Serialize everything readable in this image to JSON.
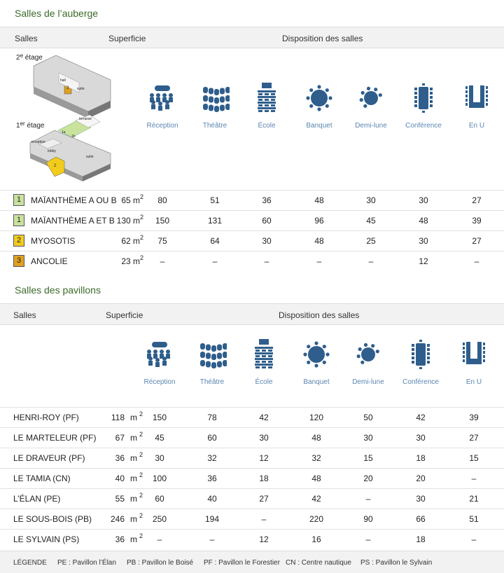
{
  "auberge": {
    "title": "Salles de l’auberge",
    "headers": {
      "salles": "Salles",
      "superficie": "Superficie",
      "disposition": "Disposition des salles"
    },
    "plan": {
      "floor2_label": "2",
      "floor2_suffix": "e",
      "floor2_word": " étage",
      "floor1_label": "1",
      "floor1_suffix": "er",
      "floor1_word": " étage",
      "tags": [
        "hall",
        "suite",
        "terrasse",
        "1a",
        "1b",
        "réception",
        "lobby",
        "suite"
      ],
      "room_numbers": [
        "3",
        "2"
      ]
    },
    "rows": [
      {
        "badge": "1",
        "badge_color": "#c9e29c",
        "name": "MAÏANTHÈME A OU B",
        "area": "65 m",
        "values": [
          "80",
          "51",
          "36",
          "48",
          "30",
          "30",
          "27"
        ]
      },
      {
        "badge": "1",
        "badge_color": "#c9e29c",
        "name": "MAÏANTHÈME A ET B",
        "area": "130 m",
        "values": [
          "150",
          "131",
          "60",
          "96",
          "45",
          "48",
          "39"
        ]
      },
      {
        "badge": "2",
        "badge_color": "#f1cc1c",
        "name": "MYOSOTIS",
        "area": "62 m",
        "values": [
          "75",
          "64",
          "30",
          "48",
          "25",
          "30",
          "27"
        ]
      },
      {
        "badge": "3",
        "badge_color": "#e0a020",
        "name": "ANCOLIE",
        "area": "23 m",
        "values": [
          "–",
          "–",
          "–",
          "–",
          "–",
          "12",
          "–"
        ]
      }
    ]
  },
  "pavillons": {
    "title": "Salles des pavillons",
    "headers": {
      "salles": "Salles",
      "superficie": "Superficie",
      "disposition": "Disposition des salles"
    },
    "rows": [
      {
        "name": "HENRI-ROY (PF)",
        "area": "118",
        "values": [
          "150",
          "78",
          "42",
          "120",
          "50",
          "42",
          "39"
        ]
      },
      {
        "name": "LE MARTELEUR (PF)",
        "area": "67",
        "values": [
          "45",
          "60",
          "30",
          "48",
          "30",
          "30",
          "27"
        ]
      },
      {
        "name": "LE DRAVEUR (PF)",
        "area": "36",
        "values": [
          "30",
          "32",
          "12",
          "32",
          "15",
          "18",
          "15"
        ]
      },
      {
        "name": "LE TAMIA (CN)",
        "area": "40",
        "values": [
          "100",
          "36",
          "18",
          "48",
          "20",
          "20",
          "–"
        ]
      },
      {
        "name": "L’ÉLAN (PE)",
        "area": "55",
        "values": [
          "60",
          "40",
          "27",
          "42",
          "–",
          "30",
          "21"
        ]
      },
      {
        "name": "LE SOUS-BOIS (PB)",
        "area": "246",
        "values": [
          "250",
          "194",
          "–",
          "220",
          "90",
          "66",
          "51"
        ]
      },
      {
        "name": "LE SYLVAIN (PS)",
        "area": "36",
        "values": [
          "–",
          "–",
          "12",
          "16",
          "–",
          "18",
          "–"
        ]
      }
    ],
    "unit": "m",
    "unit_sup": "2"
  },
  "layouts": [
    {
      "icon": "reception-icon",
      "label": "Réception"
    },
    {
      "icon": "theatre-icon",
      "label": "Théâtre"
    },
    {
      "icon": "ecole-icon",
      "label": "École"
    },
    {
      "icon": "banquet-icon",
      "label": "Banquet"
    },
    {
      "icon": "demi-lune-icon",
      "label": "Demi-lune"
    },
    {
      "icon": "conference-icon",
      "label": "Conférence"
    },
    {
      "icon": "en-u-icon",
      "label": "En U"
    }
  ],
  "legend": {
    "title": "LÉGENDE",
    "items": [
      "PE : Pavillon l’Élan",
      "PB : Pavillon le Boisé",
      "PF : Pavillon le Forestier",
      "CN : Centre nautique",
      "PS : Pavillon le Sylvain"
    ]
  },
  "colors": {
    "title": "#3b6b2a",
    "icon": "#2f5e8c",
    "label": "#5b86b0"
  }
}
